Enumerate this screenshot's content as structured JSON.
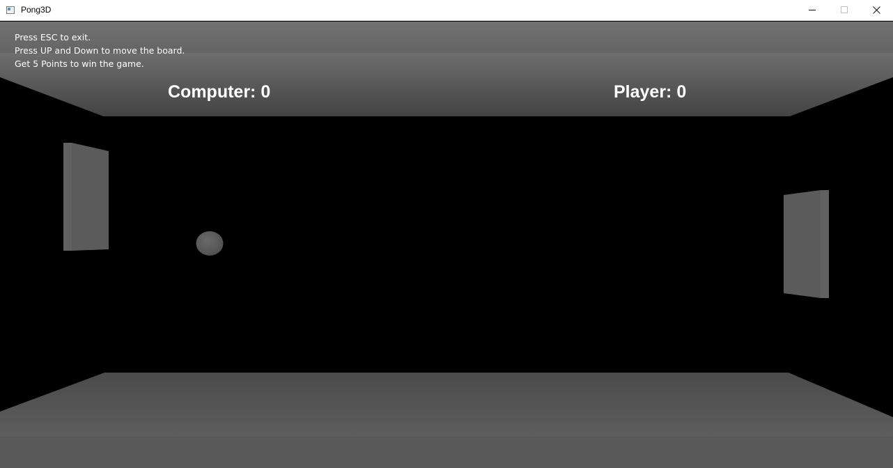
{
  "window": {
    "title": "Pong3D",
    "icon": "app-window-icon",
    "controls": [
      "minimize-icon",
      "maximize-icon",
      "close-icon"
    ]
  },
  "instructions": [
    "Press ESC to exit.",
    "Press UP and Down to move the board.",
    "Get 5 Points to win the game."
  ],
  "score": {
    "computer_label": "Computer: 0",
    "player_label": "Player: 0"
  },
  "colors": {
    "background": "#000000",
    "walls": "#4f4f4f",
    "paddles": "#5a5a5a",
    "ball": "#5e5e5e",
    "text": "#ffffff"
  }
}
